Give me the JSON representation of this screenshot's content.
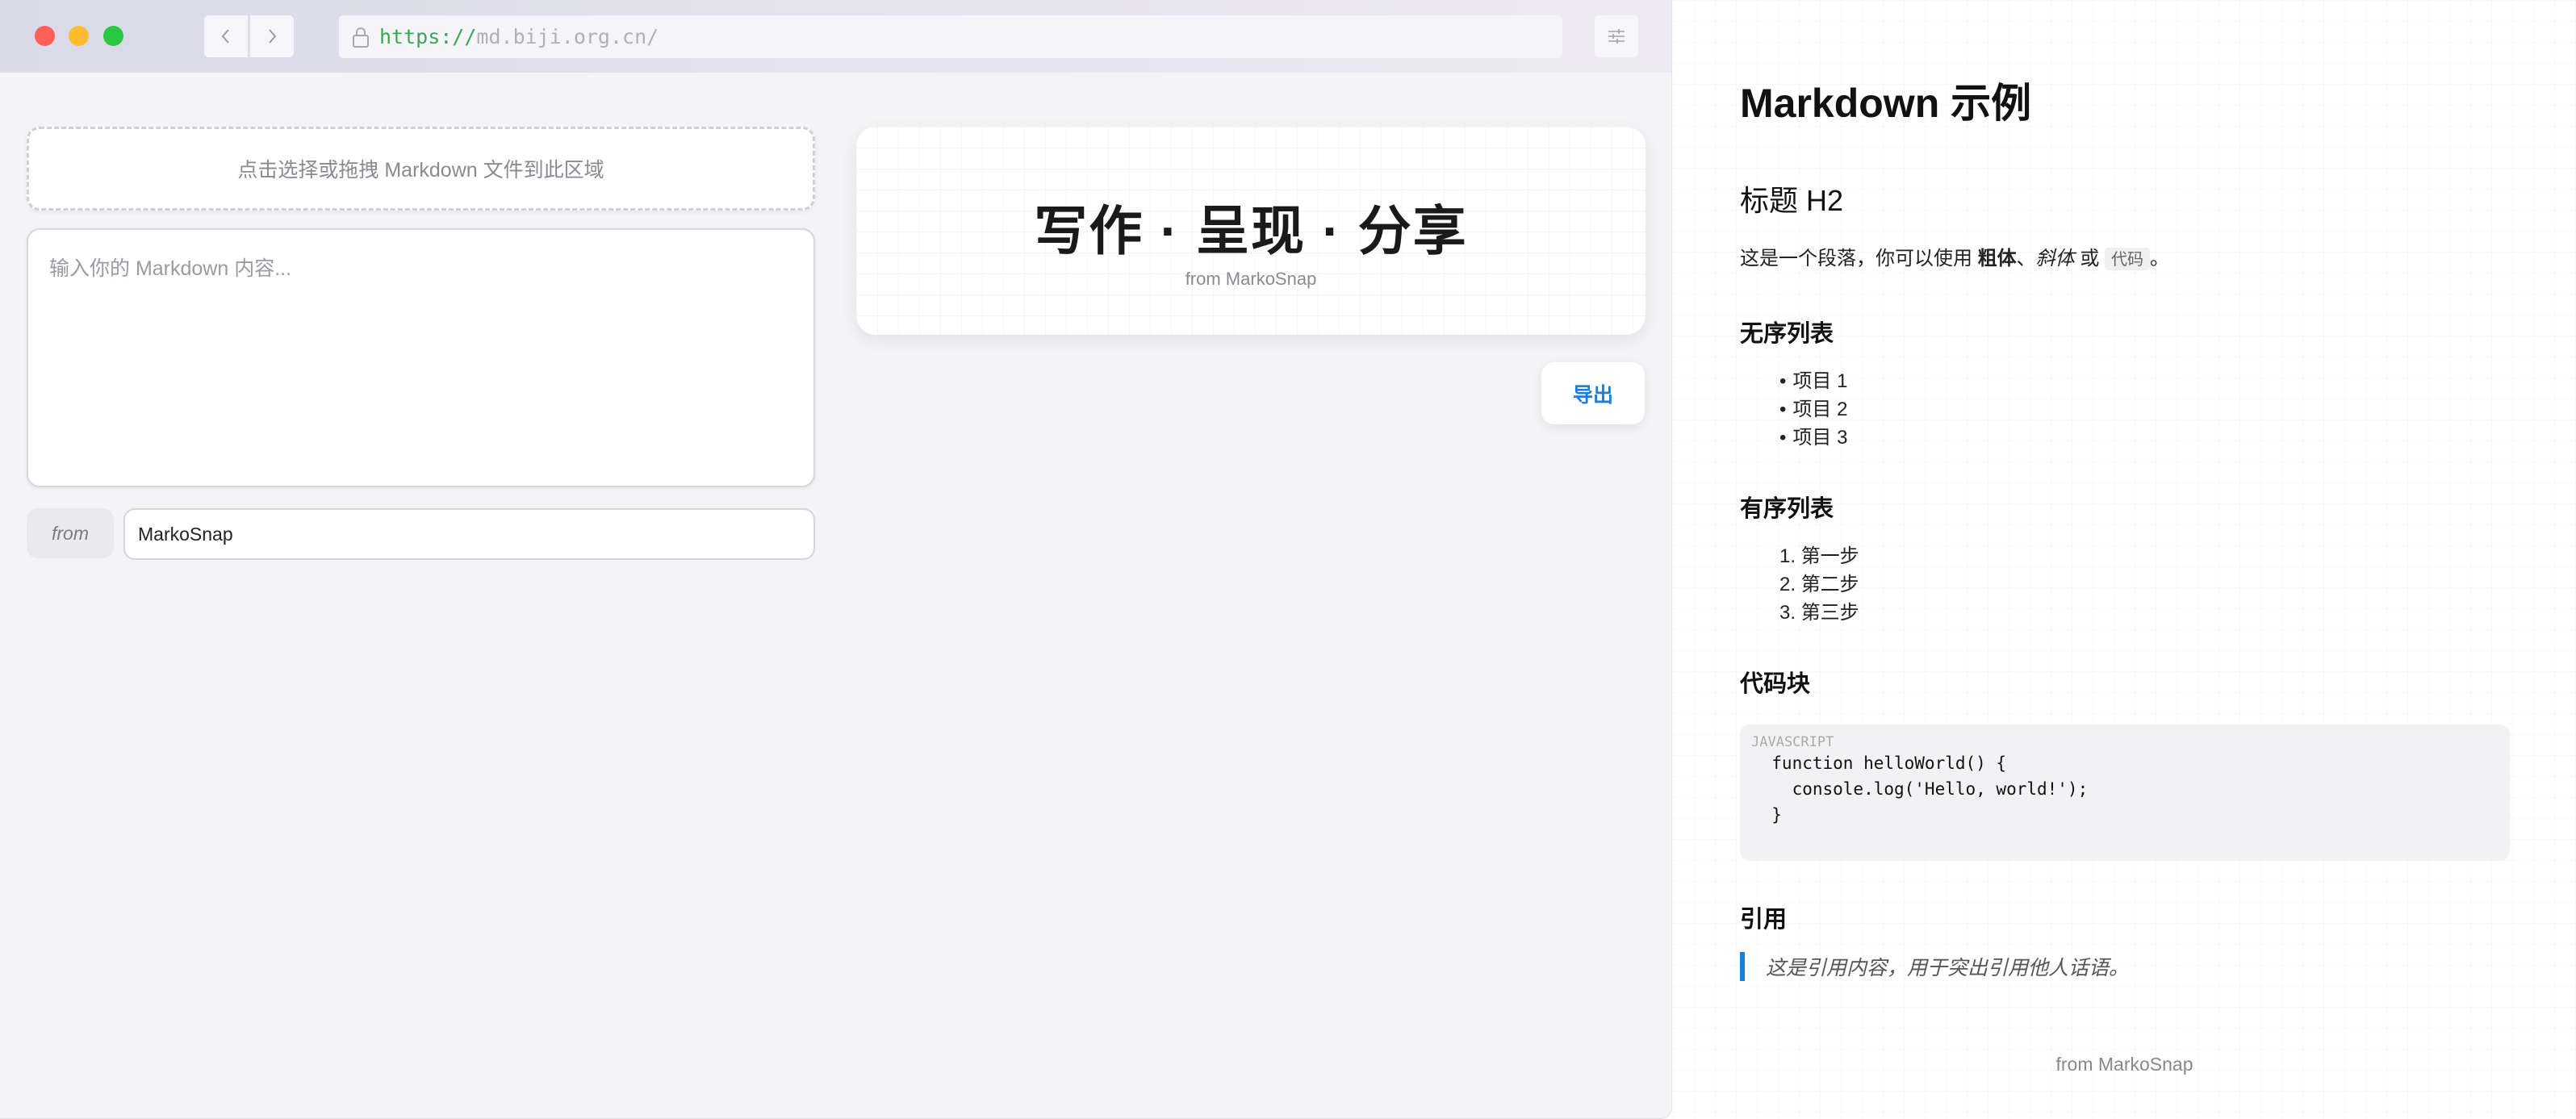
{
  "browser": {
    "url_scheme": "https://",
    "url_rest": "md.biji.org.cn/"
  },
  "editor": {
    "dropzone_text": "点击选择或拖拽 Markdown 文件到此区域",
    "placeholder": "输入你的 Markdown 内容...",
    "from_label": "from",
    "from_value": "MarkoSnap"
  },
  "card": {
    "title": "写作 · 呈现 · 分享",
    "from": "from MarkoSnap"
  },
  "actions": {
    "export_label": "导出"
  },
  "preview": {
    "h1": "Markdown 示例",
    "h2": "标题 H2",
    "para_prefix": "这是一个段落，你可以使用 ",
    "para_bold": "粗体",
    "para_sep1": "、",
    "para_italic": "斜体",
    "para_sep2": " 或 ",
    "para_code": "代码",
    "para_suffix": "。",
    "ul_heading": "无序列表",
    "ul_items": [
      "项目 1",
      "项目 2",
      "项目 3"
    ],
    "ol_heading": "有序列表",
    "ol_numbers": [
      "1.",
      "2.",
      "3."
    ],
    "ol_items": [
      "第一步",
      "第二步",
      "第三步"
    ],
    "code_heading": "代码块",
    "code_lang": "JAVASCRIPT",
    "code_lines": [
      "  function helloWorld() {",
      "    console.log('Hello, world!');",
      "  }"
    ],
    "quote_heading": "引用",
    "quote_text": "这是引用内容，用于突出引用他人话语。",
    "footer": "from MarkoSnap"
  },
  "colors": {
    "accent": "#1c7ed6",
    "traffic_red": "#fe5f57",
    "traffic_yellow": "#febc2e",
    "traffic_green": "#28c840",
    "url_scheme": "#3aa757"
  },
  "icons": [
    "lock-icon",
    "chevron-left-icon",
    "chevron-right-icon",
    "sliders-icon"
  ]
}
